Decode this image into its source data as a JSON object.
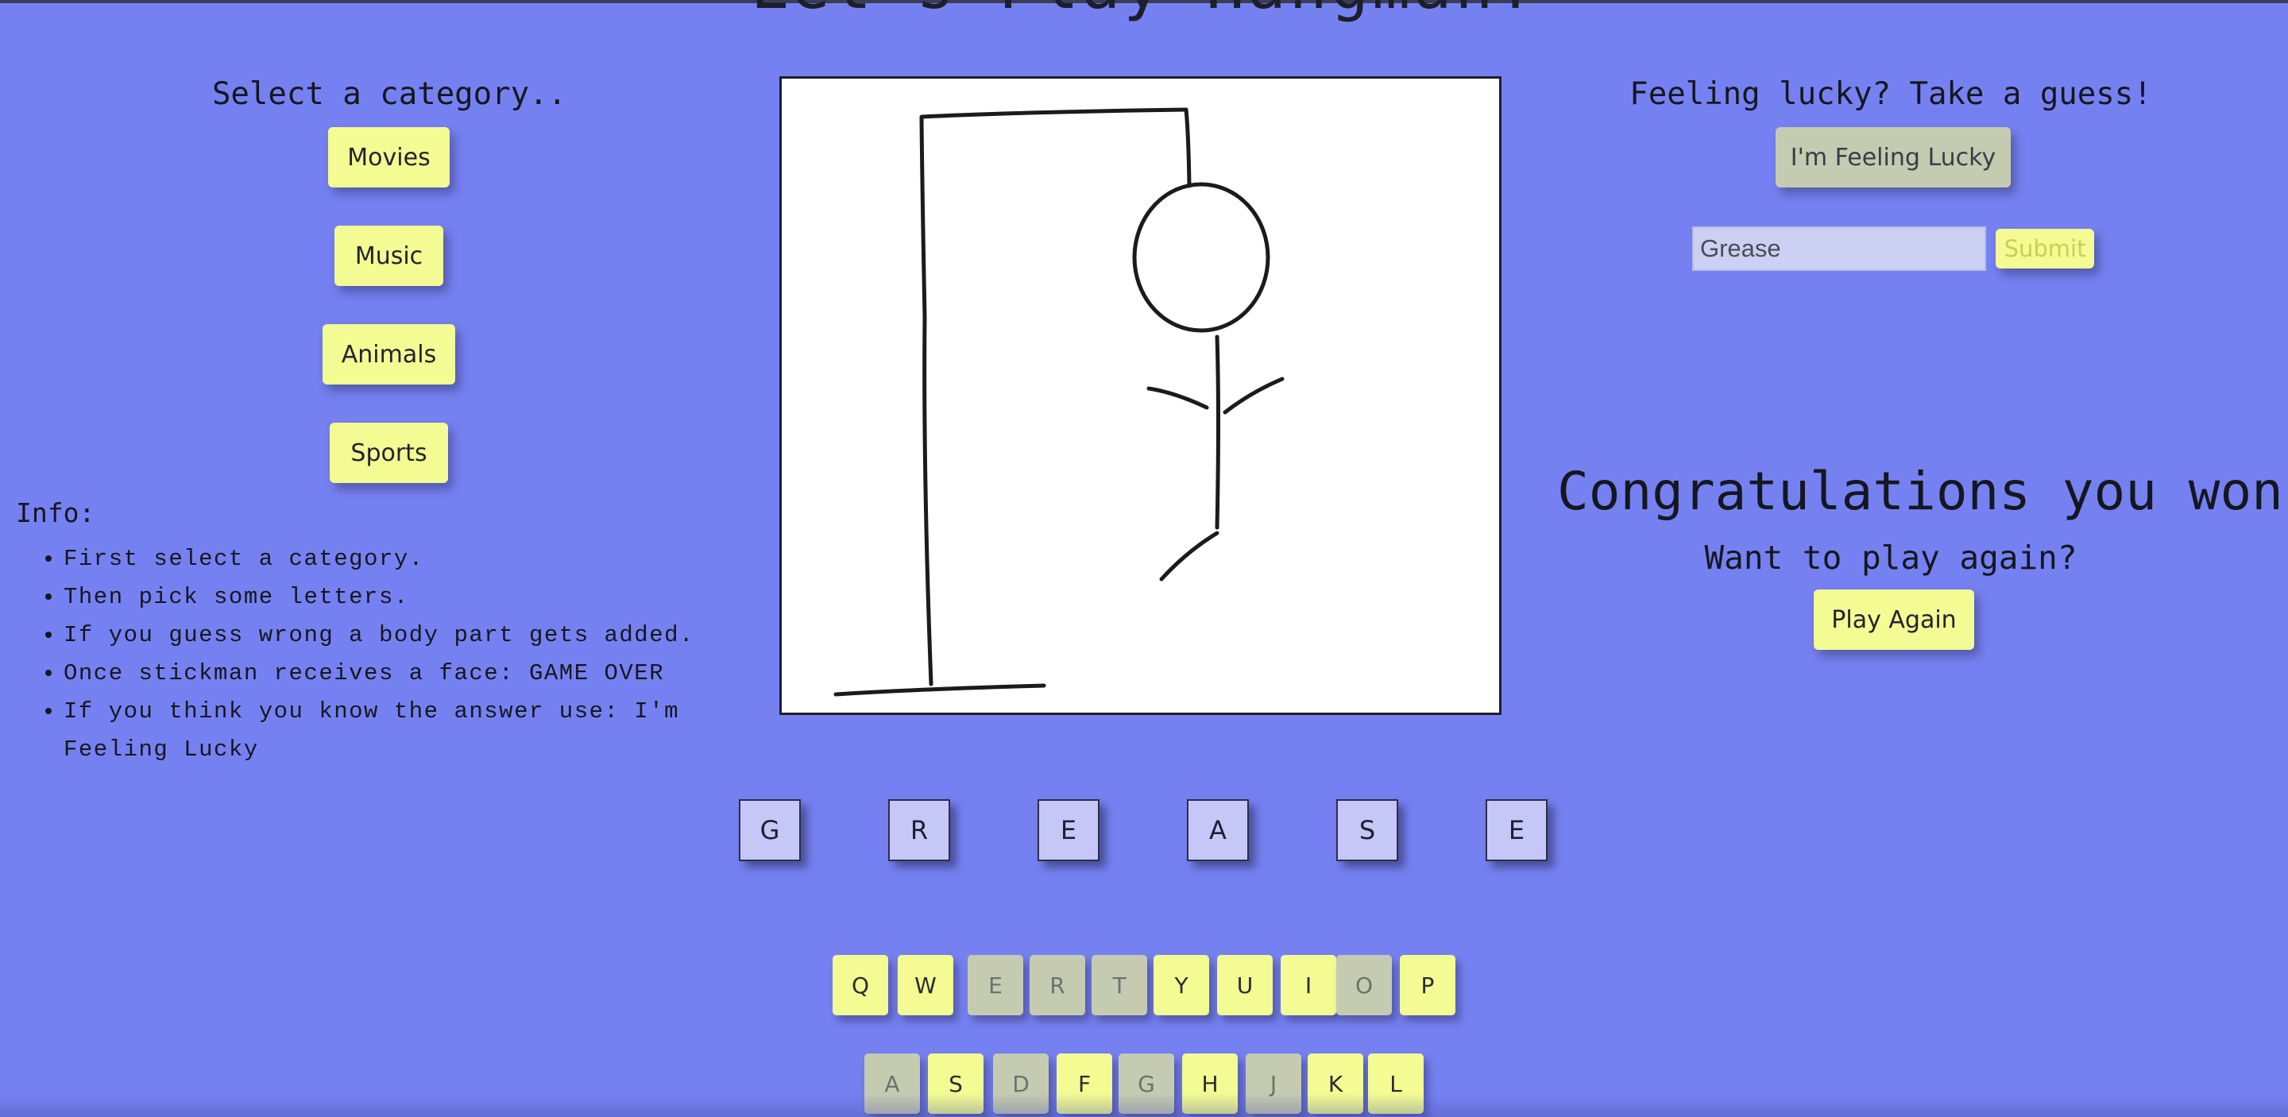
{
  "header": {
    "title": "Let's Play Hangman!"
  },
  "category": {
    "heading": "Select a category..",
    "buttons": [
      "Movies",
      "Music",
      "Animals",
      "Sports"
    ]
  },
  "info": {
    "label": "Info:",
    "items": [
      "First select a category.",
      "Then pick some letters.",
      "If you guess wrong a body part gets added.",
      "Once stickman receives a face: GAME OVER",
      "If you think you know the answer use: I'm Feeling Lucky"
    ]
  },
  "guess": {
    "heading": "Feeling lucky? Take a guess!",
    "lucky_button": "I'm Feeling Lucky",
    "input_value": "Grease",
    "submit_label": "Submit"
  },
  "result": {
    "message": "Congratulations you won!",
    "prompt": "Want to play again?",
    "play_again_label": "Play Again"
  },
  "word": {
    "letters": [
      "G",
      "R",
      "E",
      "A",
      "S",
      "E"
    ]
  },
  "keyboard": {
    "row1": [
      {
        "key": "Q",
        "used": false
      },
      {
        "key": "W",
        "used": false
      },
      {
        "key": "E",
        "used": true
      },
      {
        "key": "R",
        "used": true
      },
      {
        "key": "T",
        "used": true
      },
      {
        "key": "Y",
        "used": false
      },
      {
        "key": "U",
        "used": false
      },
      {
        "key": "I",
        "used": false
      },
      {
        "key": "O",
        "used": true
      },
      {
        "key": "P",
        "used": false
      }
    ],
    "row2": [
      {
        "key": "A",
        "used": true
      },
      {
        "key": "S",
        "used": false
      },
      {
        "key": "D",
        "used": true
      },
      {
        "key": "F",
        "used": false
      },
      {
        "key": "G",
        "used": true
      },
      {
        "key": "H",
        "used": false
      },
      {
        "key": "J",
        "used": true
      },
      {
        "key": "K",
        "used": false
      },
      {
        "key": "L",
        "used": false
      }
    ]
  },
  "colors": {
    "background": "#7681f1",
    "button": "#f3fb92",
    "button_used": "#c5cbb0",
    "letter_slot": "#c5c8f7"
  }
}
